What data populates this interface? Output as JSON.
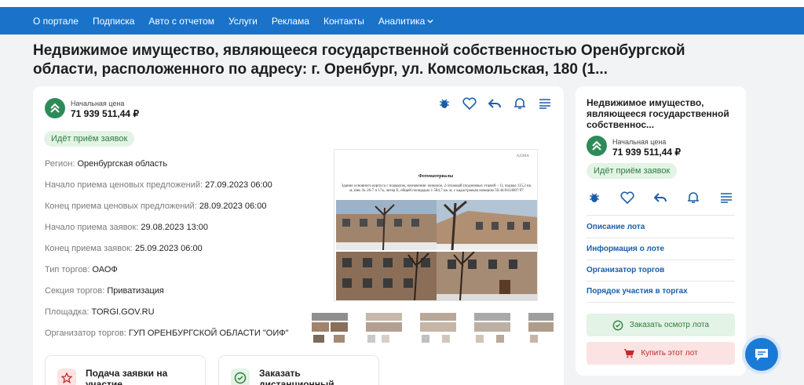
{
  "nav": {
    "items": [
      "О портале",
      "Подписка",
      "Авто с отчетом",
      "Услуги",
      "Реклама",
      "Контакты",
      "Аналитика"
    ]
  },
  "page": {
    "title": "Недвижимое имущество, являющееся государственной собственностью Оренбургской области, расположенного по адресу: г. Оренбург, ул. Комсомольская, 180 (1..."
  },
  "lot": {
    "price_label": "Начальная цена",
    "price_value": "71 939 511,44 ₽",
    "status": "Идёт приём заявок",
    "details": [
      {
        "label": "Регион:",
        "value": "Оренбургская область"
      },
      {
        "label": "Начало приема ценовых предложений:",
        "value": "27.09.2023 06:00"
      },
      {
        "label": "Конец приема ценовых предложений:",
        "value": "28.09.2023 06:00"
      },
      {
        "label": "Начало приема заявок:",
        "value": "29.08.2023 13:00"
      },
      {
        "label": "Конец приема заявок:",
        "value": "25.09.2023 06:00"
      },
      {
        "label": "Тип торгов:",
        "value": "ОАОФ"
      },
      {
        "label": "Секция торгов:",
        "value": "Приватизация"
      },
      {
        "label": "Площадка:",
        "value": "TORGI.GOV.RU"
      },
      {
        "label": "Организатор торгов:",
        "value": "ГУП ОРЕНБУРГСКОЙ ОБЛАСТИ \"ОИФ\""
      }
    ],
    "photo": {
      "logo_text": "AZIMA",
      "doc_title": "Фотоматериалы",
      "doc_desc": "Здание основного корпуса с подвалом, назначение: нежилое, 2-этажный (подземных этажей – 1), подвал 115,2 кв. м, инв. № 26-7 п 17а, литер Е, общей площадью 1 584,7 кв. м, с кадастровым номером 56:44:0414007:97"
    },
    "sub_cards": [
      {
        "title": "Подача заявки на участие"
      },
      {
        "title": "Заказать дистанционный"
      }
    ]
  },
  "side": {
    "title": "Недвижимое имущество, являющееся государственной собственнос...",
    "price_label": "Начальная цена",
    "price_value": "71 939 511,44 ₽",
    "status": "Идёт приём заявок",
    "links": [
      "Описание лота",
      "Информация о лоте",
      "Организатор торгов",
      "Порядок участия в торгах"
    ],
    "btn_inspect": "Заказать осмотр лота",
    "btn_buy": "Купить этот лот"
  },
  "colors": {
    "nav_bg": "#1a73c9",
    "accent_green": "#2e8b57",
    "link_blue": "#1a5ea8",
    "buy_red": "#c62828"
  }
}
